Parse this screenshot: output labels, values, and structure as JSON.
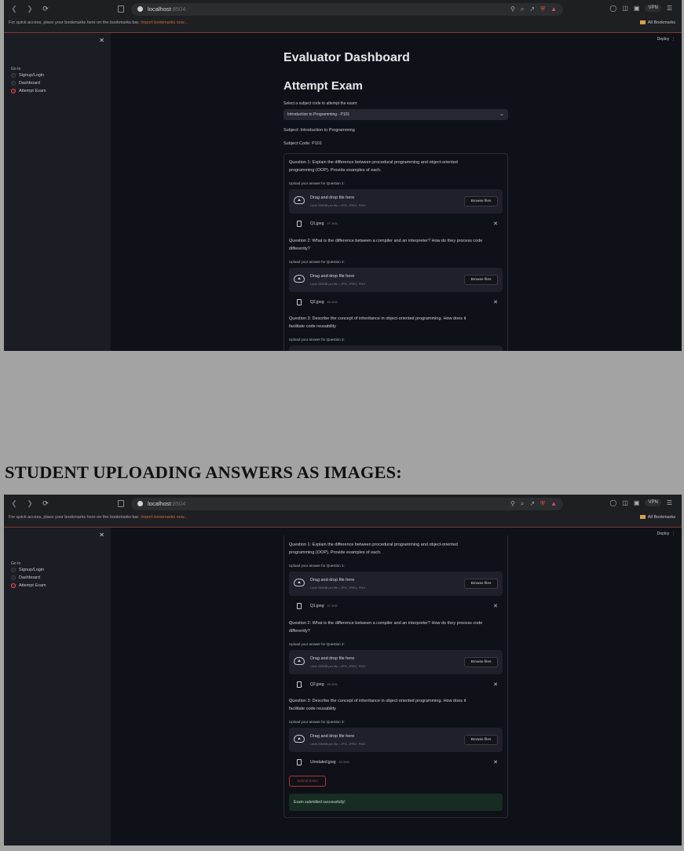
{
  "browser": {
    "host": "localhost",
    "port": ":8504",
    "bookmarks_hint": "For quick access, place your bookmarks here on the bookmarks bar.",
    "bookmarks_link": "Import bookmarks now...",
    "all_bookmarks": "All Bookmarks",
    "vpn": "VPN"
  },
  "app": {
    "deploy": "Deploy",
    "sidebar": {
      "goto": "Go to",
      "options": [
        "Signup/Login",
        "Dashboard",
        "Attempt Exam"
      ],
      "selected": "Attempt Exam"
    },
    "title": "Evaluator Dashboard",
    "section": "Attempt Exam",
    "select_label": "Select a subject code to attempt the exam:",
    "select_value": "Introduction to Programming - P101",
    "subject": "Subject: Introduction to Programming",
    "subject_code": "Subject Code: P101",
    "dropzone": {
      "drag": "Drag and drop file here",
      "limit": "Limit 200MB per file • JPG, JPEG, PNG",
      "browse": "Browse files"
    },
    "questions": [
      {
        "line1": "Question 1: Explain the difference between procedural programming and object-oriented",
        "line2": "programming (OOP). Provide examples of each.",
        "upload_label": "Upload your answer for Question 1:",
        "file": "Q1.jpeg",
        "size": "97.3KB"
      },
      {
        "line1": "Question 2: What is the difference between a compiler and an interpreter? How do they process code",
        "line2": "differently?",
        "upload_label": "Upload your answer for Question 2:",
        "file": "Q2.jpeg",
        "size": "65.1KB"
      },
      {
        "line1": "Question 3: Describe the concept of inheritance in object-oriented programming. How does it",
        "line2": "facilitate code reusability",
        "upload_label": "Upload your answer for Question 3:",
        "file": "Unrelated.jpeg",
        "size": "62.9KB"
      }
    ],
    "submit": "Submit Exam",
    "success": "Exam submitted successfully!"
  },
  "caption": "STUDENT UPLOADING ANSWERS AS IMAGES:"
}
